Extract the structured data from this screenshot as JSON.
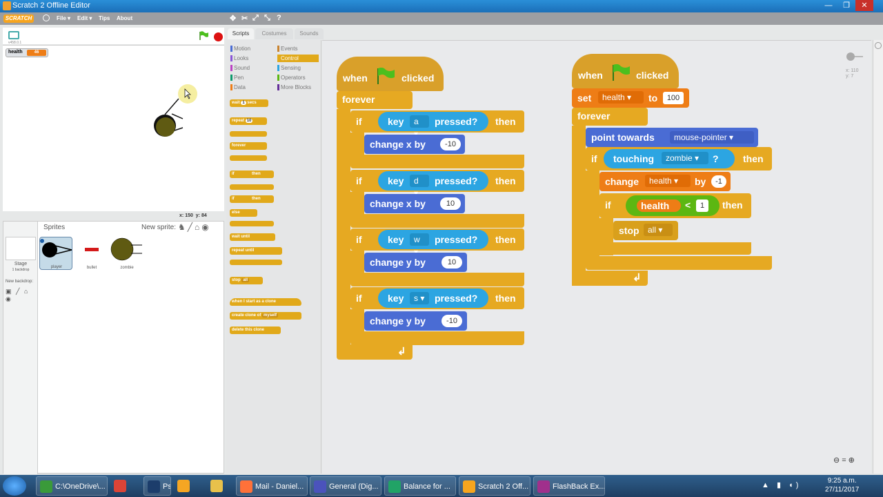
{
  "window": {
    "title": "Scratch 2 Offline Editor",
    "min": "—",
    "max": "❐",
    "close": "✕"
  },
  "menu": {
    "logo": "SCRATCH",
    "file": "File ▾",
    "edit": "Edit ▾",
    "tips": "Tips",
    "about": "About"
  },
  "toolbar": {
    "duplicate": "✥",
    "delete": "✂",
    "grow": "⤢",
    "shrink": "⤡",
    "help": "?"
  },
  "stage": {
    "version": "v458.0.1",
    "monitor_label": "health",
    "monitor_value": "46",
    "x_label": "x:",
    "x_value": "150",
    "y_label": "y:",
    "y_value": "84"
  },
  "sprites": {
    "label": "Sprites",
    "new_sprite": "New sprite:",
    "stage_label": "Stage",
    "stage_sub": "1 backdrop",
    "new_backdrop": "New backdrop:",
    "items": [
      {
        "name": "player"
      },
      {
        "name": "bullet"
      },
      {
        "name": "zombie"
      }
    ]
  },
  "tabs": [
    {
      "label": "Scripts"
    },
    {
      "label": "Costumes"
    },
    {
      "label": "Sounds"
    }
  ],
  "categories": [
    {
      "label": "Motion",
      "color": "#4a6cd4"
    },
    {
      "label": "Events",
      "color": "#c88330"
    },
    {
      "label": "Looks",
      "color": "#8a55d7"
    },
    {
      "label": "Control",
      "color": "#e1a91a"
    },
    {
      "label": "Sound",
      "color": "#bb42c3"
    },
    {
      "label": "Sensing",
      "color": "#2ca5e2"
    },
    {
      "label": "Pen",
      "color": "#0e9a6c"
    },
    {
      "label": "Operators",
      "color": "#5cb712"
    },
    {
      "label": "Data",
      "color": "#ee7d16"
    },
    {
      "label": "More Blocks",
      "color": "#632d99"
    }
  ],
  "palette": {
    "wait": "wait",
    "wait_val": "1",
    "secs": "secs",
    "repeat": "repeat",
    "repeat_val": "10",
    "forever": "forever",
    "if": "if",
    "then": "then",
    "else": "else",
    "wait_until": "wait until",
    "repeat_until": "repeat until",
    "stop": "stop",
    "stop_val": "all",
    "clone_start": "when I start as a clone",
    "create_clone": "create clone of",
    "create_clone_val": "myself",
    "delete_clone": "delete this clone"
  },
  "script1": {
    "when": "when",
    "clicked": "clicked",
    "forever": "forever",
    "if": "if",
    "key": "key",
    "pressed": "pressed?",
    "then": "then",
    "change_x": "change x by",
    "change_y": "change y by",
    "rows": [
      {
        "key": "a",
        "axis": "x",
        "value": "-10"
      },
      {
        "key": "d",
        "axis": "x",
        "value": "10"
      },
      {
        "key": "w",
        "axis": "y",
        "value": "10"
      },
      {
        "key": "s",
        "axis": "y",
        "value": "-10"
      }
    ]
  },
  "script2": {
    "when": "when",
    "clicked": "clicked",
    "set": "set",
    "set_var": "health",
    "to": "to",
    "set_val": "100",
    "forever": "forever",
    "point": "point towards",
    "point_target": "mouse-pointer",
    "if": "if",
    "touching": "touching",
    "touch_target": "zombie",
    "q": "?",
    "then": "then",
    "change": "change",
    "change_var": "health",
    "by": "by",
    "change_val": "-1",
    "if2": "if",
    "cmp_var": "health",
    "lt": "<",
    "cmp_val": "1",
    "then2": "then",
    "stop": "stop",
    "stop_val": "all"
  },
  "scripts_area": {
    "x_readout": "x: 110",
    "y_readout": "y: 7"
  },
  "taskbar": {
    "items": [
      {
        "label": "C:\\OneDrive\\...",
        "color": "#3a9a3a"
      },
      {
        "label": "",
        "color": "#db4437"
      },
      {
        "label": "Ps",
        "color": "#1c3d6b"
      },
      {
        "label": "",
        "color": "#f5a623"
      },
      {
        "label": "",
        "color": "#e8c14b"
      },
      {
        "label": "",
        "color": "#ff7139"
      },
      {
        "label": "Mail - Daniel...",
        "color": "#ff7139"
      },
      {
        "label": "General (Dig...",
        "color": "#4b53bc"
      },
      {
        "label": "Balance for ...",
        "color": "#21a366"
      },
      {
        "label": "Scratch 2 Off...",
        "color": "#f7a51e"
      },
      {
        "label": "FlashBack Ex...",
        "color": "#a0308c"
      }
    ],
    "time": "9:25 a.m.",
    "date": "27/11/2017"
  }
}
